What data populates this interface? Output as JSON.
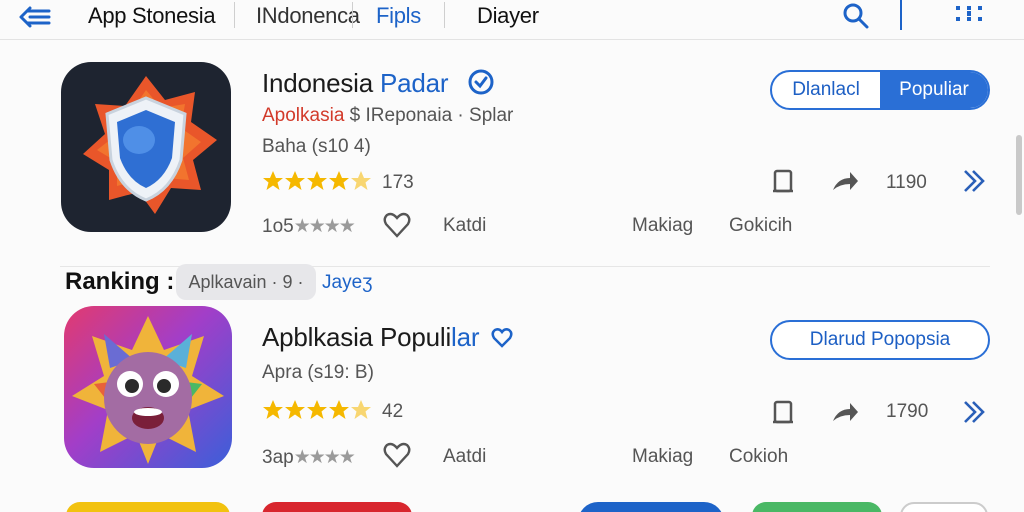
{
  "header": {
    "tabs": [
      "App Stonesia",
      "INdonenca",
      "Fipls",
      "Diayer"
    ]
  },
  "apps": [
    {
      "title_main": "Indonesia ",
      "title_accent": "Padar",
      "developer_accent": "Apolkasia",
      "developer_rest": " $ IReponaia · Splar",
      "meta": "Baha (s10  4)",
      "rating_count": "173",
      "pill_left": "Dlanlacl",
      "pill_right": "Populiar",
      "share_count": "1190",
      "foot_rating": "1o5",
      "foot_a": "Katdi",
      "foot_b": "Makiag",
      "foot_c": "Gokicih",
      "rating_value": 4.5
    },
    {
      "title_main": "Apblkasia Populi",
      "title_accent": "lar",
      "meta": "Apra (s19: B)",
      "rating_count": "42",
      "pill": "Dlarud Popopsia",
      "share_count": "1790",
      "foot_rating": "3ap",
      "foot_a": "Aatdi",
      "foot_b": "Makiag",
      "foot_c": "Cokioh",
      "rating_value": 4.5
    }
  ],
  "ranking": {
    "label": "Ranking :",
    "chip": "Aplkavain · 9 ·",
    "link": "Jayeʒ"
  },
  "colors": {
    "accent": "#1d63c8",
    "star": "#f5b800",
    "developer": "#d23a2a"
  },
  "icons": [
    "back-menu-icon",
    "search-icon",
    "grid-icon",
    "verified-icon",
    "heart-icon",
    "bookmark-icon",
    "share-icon",
    "chevron-right-icon"
  ]
}
